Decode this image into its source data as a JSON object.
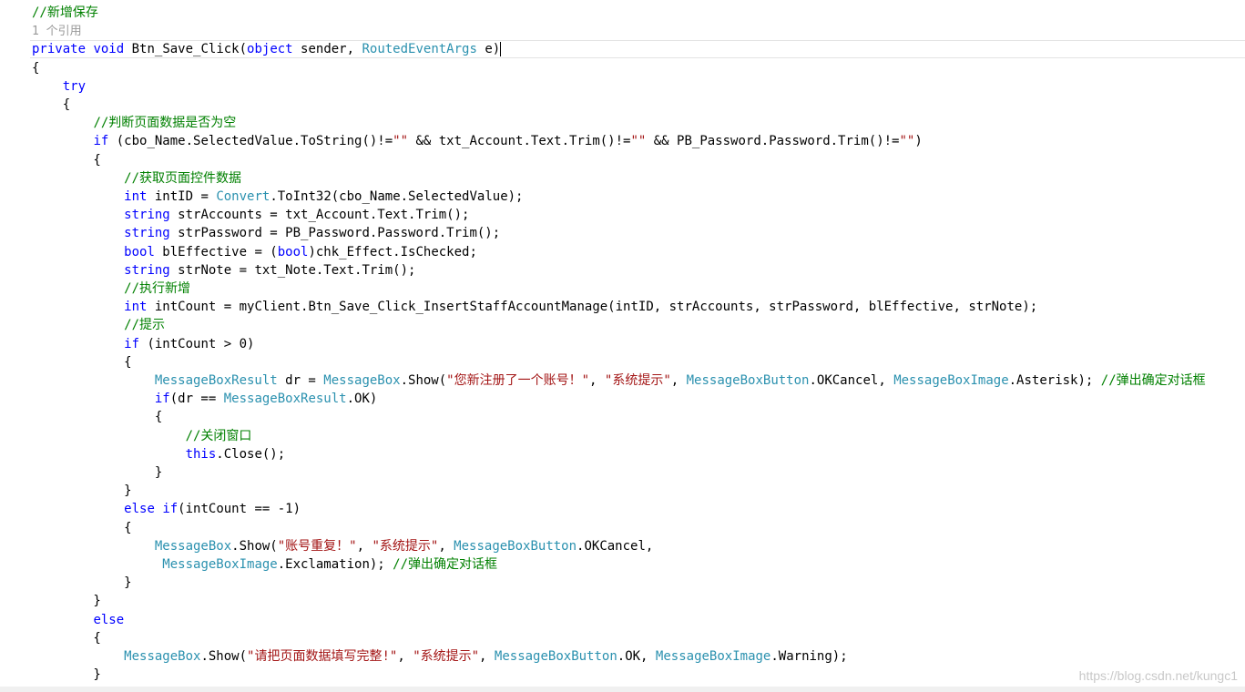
{
  "editor": {
    "lines": [
      [
        [
          "cmt",
          "//新增保存"
        ]
      ],
      [
        [
          "lens",
          "1 个引用"
        ]
      ],
      [
        [
          "kw",
          "private"
        ],
        [
          "plain",
          " "
        ],
        [
          "kw",
          "void"
        ],
        [
          "plain",
          " Btn_Save_Click("
        ],
        [
          "kw",
          "object"
        ],
        [
          "plain",
          " sender, "
        ],
        [
          "type",
          "RoutedEventArgs"
        ],
        [
          "plain",
          " e)"
        ]
      ],
      [
        [
          "plain",
          "{"
        ]
      ],
      [
        [
          "plain",
          "    "
        ],
        [
          "kw",
          "try"
        ]
      ],
      [
        [
          "plain",
          "    {"
        ]
      ],
      [
        [
          "plain",
          "        "
        ],
        [
          "cmt",
          "//判断页面数据是否为空"
        ]
      ],
      [
        [
          "plain",
          "        "
        ],
        [
          "kw",
          "if"
        ],
        [
          "plain",
          " (cbo_Name.SelectedValue.ToString()!="
        ],
        [
          "str",
          "\"\""
        ],
        [
          "plain",
          " && txt_Account.Text.Trim()!="
        ],
        [
          "str",
          "\"\""
        ],
        [
          "plain",
          " && PB_Password.Password.Trim()!="
        ],
        [
          "str",
          "\"\""
        ],
        [
          "plain",
          ")"
        ]
      ],
      [
        [
          "plain",
          "        {"
        ]
      ],
      [
        [
          "plain",
          "            "
        ],
        [
          "cmt",
          "//获取页面控件数据"
        ]
      ],
      [
        [
          "plain",
          "            "
        ],
        [
          "kw",
          "int"
        ],
        [
          "plain",
          " intID = "
        ],
        [
          "type",
          "Convert"
        ],
        [
          "plain",
          ".ToInt32(cbo_Name.SelectedValue);"
        ]
      ],
      [
        [
          "plain",
          "            "
        ],
        [
          "kw",
          "string"
        ],
        [
          "plain",
          " strAccounts = txt_Account.Text.Trim();"
        ]
      ],
      [
        [
          "plain",
          "            "
        ],
        [
          "kw",
          "string"
        ],
        [
          "plain",
          " strPassword = PB_Password.Password.Trim();"
        ]
      ],
      [
        [
          "plain",
          "            "
        ],
        [
          "kw",
          "bool"
        ],
        [
          "plain",
          " blEffective = ("
        ],
        [
          "kw",
          "bool"
        ],
        [
          "plain",
          ")chk_Effect.IsChecked;"
        ]
      ],
      [
        [
          "plain",
          "            "
        ],
        [
          "kw",
          "string"
        ],
        [
          "plain",
          " strNote = txt_Note.Text.Trim();"
        ]
      ],
      [
        [
          "plain",
          "            "
        ],
        [
          "cmt",
          "//执行新增"
        ]
      ],
      [
        [
          "plain",
          "            "
        ],
        [
          "kw",
          "int"
        ],
        [
          "plain",
          " intCount = myClient.Btn_Save_Click_InsertStaffAccountManage(intID, strAccounts, strPassword, blEffective, strNote);"
        ]
      ],
      [
        [
          "plain",
          "            "
        ],
        [
          "cmt",
          "//提示"
        ]
      ],
      [
        [
          "plain",
          "            "
        ],
        [
          "kw",
          "if"
        ],
        [
          "plain",
          " (intCount > 0)"
        ]
      ],
      [
        [
          "plain",
          "            {"
        ]
      ],
      [
        [
          "plain",
          "                "
        ],
        [
          "type",
          "MessageBoxResult"
        ],
        [
          "plain",
          " dr = "
        ],
        [
          "type",
          "MessageBox"
        ],
        [
          "plain",
          ".Show("
        ],
        [
          "str",
          "\"您新注册了一个账号！\""
        ],
        [
          "plain",
          ", "
        ],
        [
          "str",
          "\"系统提示\""
        ],
        [
          "plain",
          ", "
        ],
        [
          "type",
          "MessageBoxButton"
        ],
        [
          "plain",
          ".OKCancel, "
        ],
        [
          "type",
          "MessageBoxImage"
        ],
        [
          "plain",
          ".Asterisk); "
        ],
        [
          "cmt",
          "//弹出确定对话框"
        ]
      ],
      [
        [
          "plain",
          "                "
        ],
        [
          "kw",
          "if"
        ],
        [
          "plain",
          "(dr == "
        ],
        [
          "type",
          "MessageBoxResult"
        ],
        [
          "plain",
          ".OK)"
        ]
      ],
      [
        [
          "plain",
          "                {"
        ]
      ],
      [
        [
          "plain",
          "                    "
        ],
        [
          "cmt",
          "//关闭窗口"
        ]
      ],
      [
        [
          "plain",
          "                    "
        ],
        [
          "kw",
          "this"
        ],
        [
          "plain",
          ".Close();"
        ]
      ],
      [
        [
          "plain",
          "                }"
        ]
      ],
      [
        [
          "plain",
          "            }"
        ]
      ],
      [
        [
          "plain",
          "            "
        ],
        [
          "kw",
          "else"
        ],
        [
          "plain",
          " "
        ],
        [
          "kw",
          "if"
        ],
        [
          "plain",
          "(intCount == -1)"
        ]
      ],
      [
        [
          "plain",
          "            {"
        ]
      ],
      [
        [
          "plain",
          "                "
        ],
        [
          "type",
          "MessageBox"
        ],
        [
          "plain",
          ".Show("
        ],
        [
          "str",
          "\"账号重复！\""
        ],
        [
          "plain",
          ", "
        ],
        [
          "str",
          "\"系统提示\""
        ],
        [
          "plain",
          ", "
        ],
        [
          "type",
          "MessageBoxButton"
        ],
        [
          "plain",
          ".OKCancel,"
        ]
      ],
      [
        [
          "plain",
          "                 "
        ],
        [
          "type",
          "MessageBoxImage"
        ],
        [
          "plain",
          ".Exclamation); "
        ],
        [
          "cmt",
          "//弹出确定对话框"
        ]
      ],
      [
        [
          "plain",
          "            }"
        ]
      ],
      [
        [
          "plain",
          "        }"
        ]
      ],
      [
        [
          "plain",
          "        "
        ],
        [
          "kw",
          "else"
        ]
      ],
      [
        [
          "plain",
          "        {"
        ]
      ],
      [
        [
          "plain",
          "            "
        ],
        [
          "type",
          "MessageBox"
        ],
        [
          "plain",
          ".Show("
        ],
        [
          "str",
          "\"请把页面数据填写完整!\""
        ],
        [
          "plain",
          ", "
        ],
        [
          "str",
          "\"系统提示\""
        ],
        [
          "plain",
          ", "
        ],
        [
          "type",
          "MessageBoxButton"
        ],
        [
          "plain",
          ".OK, "
        ],
        [
          "type",
          "MessageBoxImage"
        ],
        [
          "plain",
          ".Warning);"
        ]
      ],
      [
        [
          "plain",
          "        }"
        ]
      ]
    ],
    "current_line": 2
  },
  "watermark": "https://blog.csdn.net/kungc1",
  "colors": {
    "keyword": "#0000ff",
    "type": "#2b91af",
    "string": "#a31515",
    "comment": "#008000",
    "codelens": "#999999",
    "text": "#000000",
    "background": "#ffffff"
  }
}
